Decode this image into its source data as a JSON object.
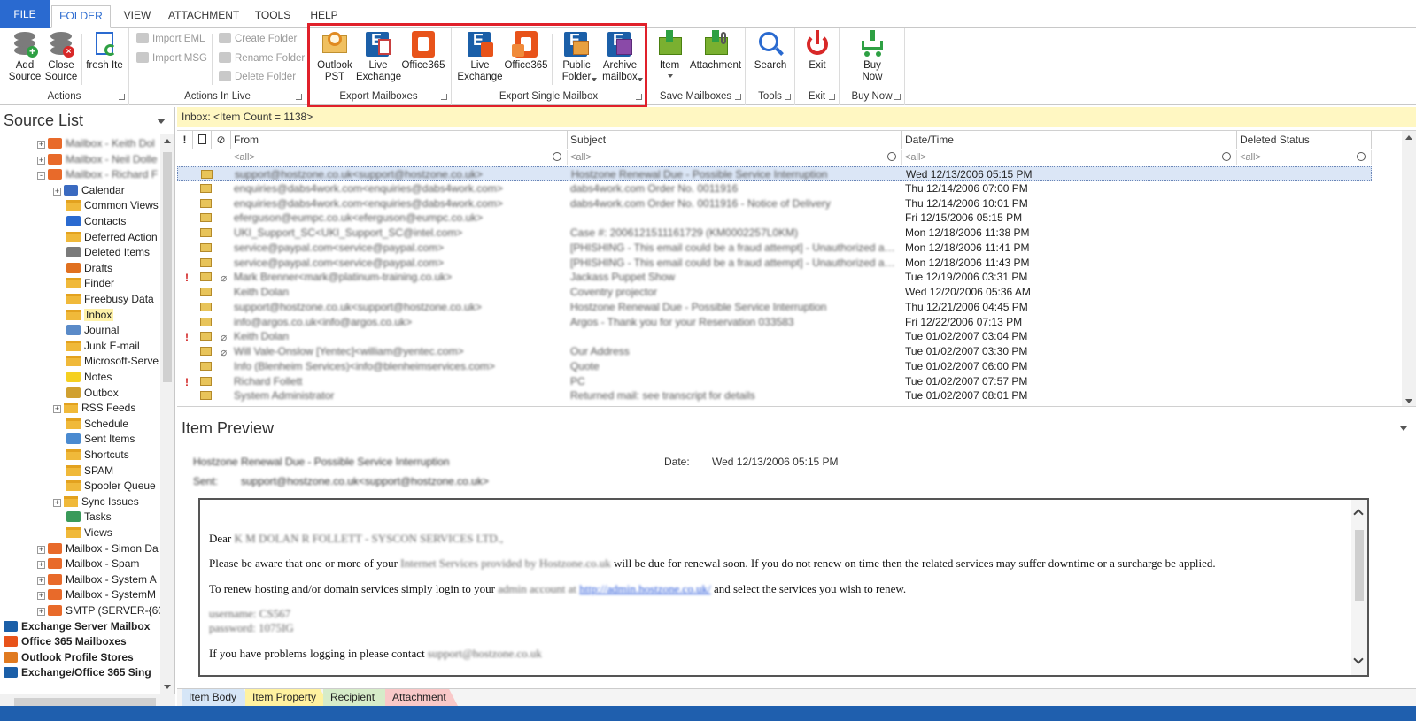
{
  "ribbon_tabs": [
    "FILE",
    "FOLDER",
    "VIEW",
    "ATTACHMENT",
    "TOOLS",
    "HELP"
  ],
  "actions_group": {
    "add_source": "Add\nSource",
    "close_source": "Close\nSource",
    "fresh_item": "fresh Ite",
    "label": "Actions"
  },
  "actions_in_live": {
    "import_eml": "Import EML",
    "import_msg": "Import MSG",
    "create_folder": "Create Folder",
    "rename_folder": "Rename Folder",
    "delete_folder": "Delete Folder",
    "label": "Actions In Live"
  },
  "export_mailboxes": {
    "outlook_pst": "Outlook\nPST",
    "live_exchange": "Live\nExchange",
    "office365": "Office365",
    "label": "Export  Mailboxes"
  },
  "export_single": {
    "live_exchange": "Live\nExchange",
    "office365": "Office365",
    "public_folder": "Public\nFolder",
    "archive_mailbox": "Archive\nmailbox",
    "label": "Export Single Mailbox"
  },
  "save_mailboxes": {
    "item": "Item",
    "attachment": "Attachment",
    "label": "Save Mailboxes"
  },
  "tools": {
    "search": "Search",
    "label": "Tools"
  },
  "exit": {
    "exit": "Exit",
    "label": "Exit"
  },
  "buy": {
    "buy_now": "Buy\nNow",
    "label": "Buy Now"
  },
  "source_list": {
    "title": "Source List",
    "nodes": [
      {
        "label": "Mailbox - Keith Dol",
        "indent": 2,
        "type": "mbox",
        "exp": "+",
        "blur": true
      },
      {
        "label": "Mailbox - Neil Dolle",
        "indent": 2,
        "type": "mbox",
        "exp": "+",
        "blur": true
      },
      {
        "label": "Mailbox - Richard F",
        "indent": 2,
        "type": "mbox",
        "exp": "-",
        "blur": true
      },
      {
        "label": "Calendar",
        "indent": 3,
        "type": "calendar",
        "exp": "+"
      },
      {
        "label": "Common Views",
        "indent": 3,
        "type": "folder"
      },
      {
        "label": "Contacts",
        "indent": 3,
        "type": "contacts"
      },
      {
        "label": "Deferred Action",
        "indent": 3,
        "type": "folder"
      },
      {
        "label": "Deleted Items",
        "indent": 3,
        "type": "deleted"
      },
      {
        "label": "Drafts",
        "indent": 3,
        "type": "drafts"
      },
      {
        "label": "Finder",
        "indent": 3,
        "type": "folder"
      },
      {
        "label": "Freebusy Data",
        "indent": 3,
        "type": "folder"
      },
      {
        "label": "Inbox",
        "indent": 3,
        "type": "folder",
        "selected": true
      },
      {
        "label": "Journal",
        "indent": 3,
        "type": "journal"
      },
      {
        "label": "Junk E-mail",
        "indent": 3,
        "type": "folder"
      },
      {
        "label": "Microsoft-Serve",
        "indent": 3,
        "type": "folder"
      },
      {
        "label": "Notes",
        "indent": 3,
        "type": "notes"
      },
      {
        "label": "Outbox",
        "indent": 3,
        "type": "outbox"
      },
      {
        "label": "RSS Feeds",
        "indent": 3,
        "type": "folder",
        "exp": "+"
      },
      {
        "label": "Schedule",
        "indent": 3,
        "type": "folder"
      },
      {
        "label": "Sent Items",
        "indent": 3,
        "type": "sent"
      },
      {
        "label": "Shortcuts",
        "indent": 3,
        "type": "folder"
      },
      {
        "label": "SPAM",
        "indent": 3,
        "type": "folder"
      },
      {
        "label": "Spooler Queue",
        "indent": 3,
        "type": "folder"
      },
      {
        "label": "Sync Issues",
        "indent": 3,
        "type": "folder",
        "exp": "+"
      },
      {
        "label": "Tasks",
        "indent": 3,
        "type": "tasks"
      },
      {
        "label": "Views",
        "indent": 3,
        "type": "folder"
      },
      {
        "label": "Mailbox - Simon Da",
        "indent": 2,
        "type": "mbox",
        "exp": "+"
      },
      {
        "label": "Mailbox - Spam",
        "indent": 2,
        "type": "mbox",
        "exp": "+"
      },
      {
        "label": "Mailbox - System A",
        "indent": 2,
        "type": "mbox",
        "exp": "+"
      },
      {
        "label": "Mailbox - SystemM",
        "indent": 2,
        "type": "mbox",
        "exp": "+"
      },
      {
        "label": "SMTP (SERVER-{60C",
        "indent": 2,
        "type": "mbox",
        "exp": "+"
      },
      {
        "label": "Exchange Server Mailbox",
        "indent": 1,
        "type": "exchange",
        "bold": true
      },
      {
        "label": "Office 365 Mailboxes",
        "indent": 1,
        "type": "office",
        "bold": true
      },
      {
        "label": "Outlook Profile Stores",
        "indent": 1,
        "type": "outlook",
        "bold": true
      },
      {
        "label": "Exchange/Office 365 Sing",
        "indent": 1,
        "type": "exchange",
        "bold": true
      }
    ]
  },
  "folder_bar": "Inbox: <Item Count = 1138>",
  "list": {
    "columns": {
      "from": "From",
      "subject": "Subject",
      "date": "Date/Time",
      "deleted": "Deleted Status"
    },
    "filter_placeholder": "<all>",
    "rows": [
      {
        "from": "support@hostzone.co.uk<support@hostzone.co.uk>",
        "subject": "Hostzone Renewal Due - Possible Service Interruption",
        "date": "Wed 12/13/2006 05:15 PM",
        "flag": false,
        "clip": false,
        "selected": true,
        "blur": true
      },
      {
        "from": "enquiries@dabs4work.com<enquiries@dabs4work.com>",
        "subject": "dabs4work.com Order No. 0011916",
        "date": "Thu 12/14/2006 07:00 PM",
        "flag": false,
        "clip": false,
        "blur": true
      },
      {
        "from": "enquiries@dabs4work.com<enquiries@dabs4work.com>",
        "subject": "dabs4work.com Order No. 0011916 - Notice of Delivery",
        "date": "Thu 12/14/2006 10:01 PM",
        "flag": false,
        "clip": false,
        "blur": true
      },
      {
        "from": "eferguson@eumpc.co.uk<eferguson@eumpc.co.uk>",
        "subject": "",
        "date": "Fri 12/15/2006 05:15 PM",
        "flag": false,
        "clip": false,
        "blur": true
      },
      {
        "from": "UKI_Support_SC<UKI_Support_SC@intel.com>",
        "subject": "Case #: 2006121511161729 (KM0002257L0KM)",
        "date": "Mon 12/18/2006 11:38 PM",
        "flag": false,
        "clip": false,
        "blur": true
      },
      {
        "from": "service@paypal.com<service@paypal.com>",
        "subject": "[PHISHING - This email could be a fraud attempt] - Unauthorized access to yo...",
        "date": "Mon 12/18/2006 11:41 PM",
        "flag": false,
        "clip": false,
        "blur": true
      },
      {
        "from": "service@paypal.com<service@paypal.com>",
        "subject": "[PHISHING - This email could be a fraud attempt] - Unauthorized access to yo...",
        "date": "Mon 12/18/2006 11:43 PM",
        "flag": false,
        "clip": false,
        "blur": true
      },
      {
        "from": "Mark Brenner<mark@platinum-training.co.uk>",
        "subject": "Jackass Puppet Show",
        "date": "Tue 12/19/2006 03:31 PM",
        "flag": true,
        "clip": true,
        "blur": true
      },
      {
        "from": "Keith Dolan",
        "subject": "Coventry projector",
        "date": "Wed 12/20/2006 05:36 AM",
        "flag": false,
        "clip": false,
        "blur": true
      },
      {
        "from": "support@hostzone.co.uk<support@hostzone.co.uk>",
        "subject": "Hostzone Renewal Due - Possible Service Interruption",
        "date": "Thu 12/21/2006 04:45 PM",
        "flag": false,
        "clip": false,
        "blur": true
      },
      {
        "from": "info@argos.co.uk<info@argos.co.uk>",
        "subject": "Argos - Thank you for your Reservation 033583",
        "date": "Fri 12/22/2006 07:13 PM",
        "flag": false,
        "clip": false,
        "blur": true
      },
      {
        "from": "Keith Dolan",
        "subject": "",
        "date": "Tue 01/02/2007 03:04 PM",
        "flag": true,
        "clip": true,
        "blur": true
      },
      {
        "from": "Will Vale-Onslow [Yentec]<william@yentec.com>",
        "subject": "Our Address",
        "date": "Tue 01/02/2007 03:30 PM",
        "flag": false,
        "clip": true,
        "blur": true
      },
      {
        "from": "Info (Blenheim Services)<info@blenheimservices.com>",
        "subject": "Quote",
        "date": "Tue 01/02/2007 06:00 PM",
        "flag": false,
        "clip": false,
        "blur": true
      },
      {
        "from": "Richard Follett",
        "subject": "PC",
        "date": "Tue 01/02/2007 07:57 PM",
        "flag": true,
        "clip": false,
        "blur": true
      },
      {
        "from": "System Administrator",
        "subject": "Returned mail: see transcript for details",
        "date": "Tue 01/02/2007 08:01 PM",
        "flag": false,
        "clip": false,
        "blur": true
      }
    ]
  },
  "preview": {
    "title": "Item Preview",
    "subject": "Hostzone Renewal Due - Possible Service Interruption",
    "date_label": "Date:",
    "date_value": "Wed 12/13/2006 05:15 PM",
    "sent_label": "Sent:",
    "sent_value": "support@hostzone.co.uk<support@hostzone.co.uk>",
    "body": {
      "greeting_a": "Dear",
      "greeting_b": "K M DOLAN  R FOLLETT - SYSCON SERVICES LTD.,",
      "p1_a": "Please be aware that one or more of your",
      "p1_b": "Internet Services provided by Hostzone.co.uk",
      "p1_c": "will be due for renewal soon. If you do not renew on time then the related services may suffer downtime or a surcharge be applied.",
      "p2_a": "To renew hosting and/or domain services simply login to your",
      "p2_b": "admin account at",
      "p2_link": "http://admin.hostzone.co.uk/",
      "p2_c": "and select the services you wish to renew.",
      "username": "username: CS567",
      "password": "password: 1075IG",
      "p3_a": "If you have problems logging in please contact",
      "p3_b": "support@hostzone.co.uk"
    }
  },
  "bottom_tabs": [
    {
      "label": "Item Body",
      "color": "#d6e6f7"
    },
    {
      "label": "Item Property",
      "color": "#fff2a0"
    },
    {
      "label": "Recipient",
      "color": "#d6ecc9"
    },
    {
      "label": "Attachment",
      "color": "#f9c8c8"
    }
  ],
  "colors": {
    "accent": "#2a6ad0",
    "highlight": "#e0202a",
    "folder_bar": "#fff7c2",
    "status_bar": "#1f5fae"
  }
}
